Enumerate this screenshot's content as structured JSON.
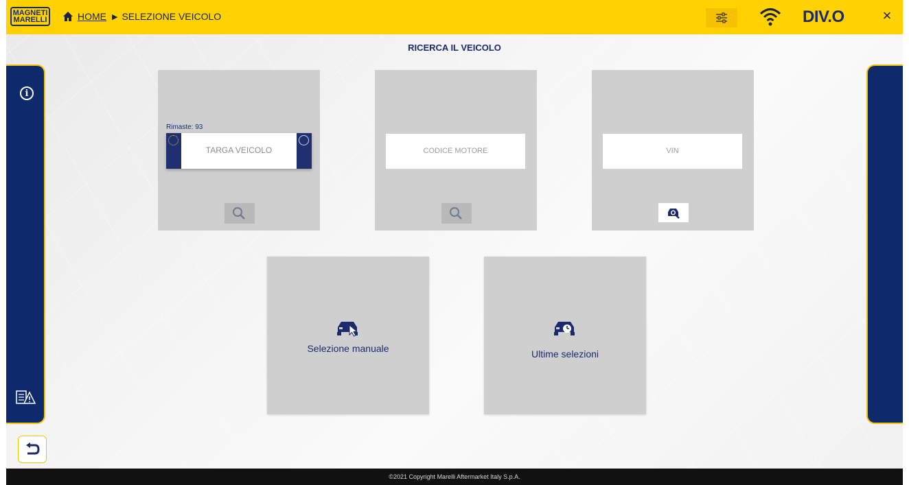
{
  "header": {
    "logo_line1": "MAGNETI",
    "logo_line2": "MARELLI",
    "home_label": "HOME",
    "current_page": "SELEZIONE VEICOLO",
    "brand": "DIV.O",
    "close_label": "×"
  },
  "main": {
    "title": "RICERCA IL VEICOLO",
    "plate_card": {
      "remaining": "Rimaste: 93",
      "plate_placeholder": "TARGA VEICOLO"
    },
    "engine_card": {
      "placeholder": "CODICE MOTORE"
    },
    "vin_card": {
      "placeholder": "VIN"
    },
    "manual_selection_label": "Selezione manuale",
    "recent_selections_label": "Ultime selezioni"
  },
  "footer": {
    "copyright": "©2021 Copyright Marelli Aftermarket Italy S.p.A."
  },
  "colors": {
    "header_yellow": "#ffd200",
    "navy": "#0e2a6b",
    "card_gray": "#cfcfcf"
  },
  "icons": {
    "home": "home-icon",
    "settings": "sliders-icon",
    "wifi": "wifi-icon",
    "close": "close-icon",
    "info": "info-icon",
    "warning": "vehicle-warning-icon",
    "back": "back-arrow-icon",
    "search": "search-icon",
    "vin_search": "vin-scan-icon",
    "manual": "car-cursor-icon",
    "recent": "car-clock-icon"
  }
}
